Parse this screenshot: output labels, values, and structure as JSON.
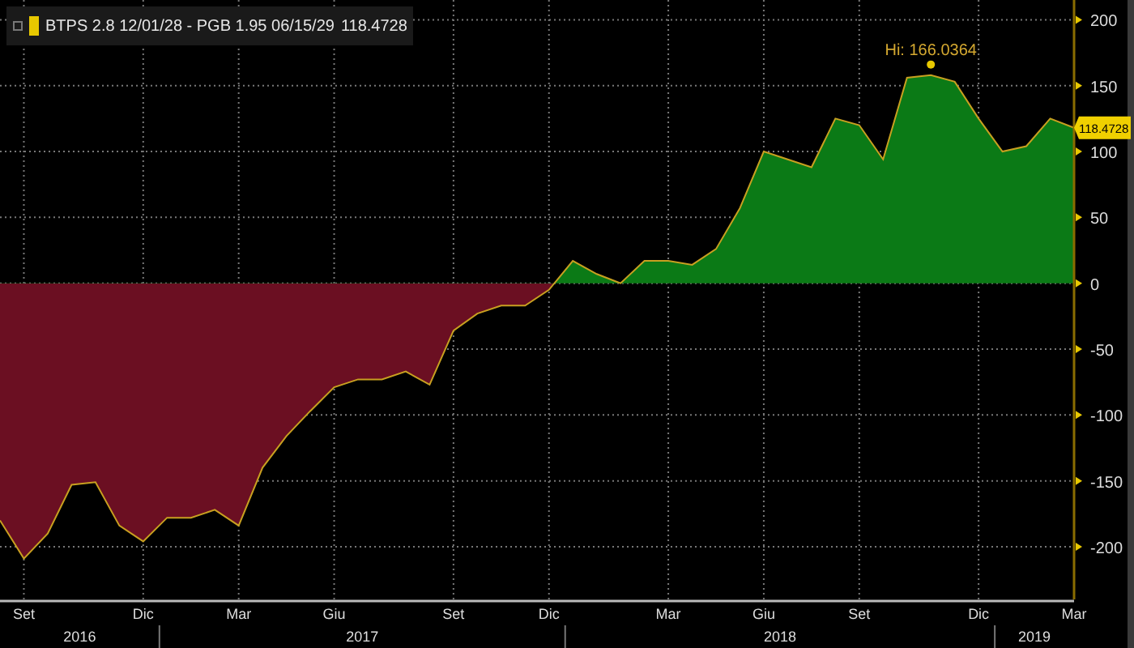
{
  "legend": {
    "value": "118.4728",
    "color": "#e8c800"
  },
  "chart_data": {
    "type": "area",
    "categories": [
      null,
      "Set",
      null,
      null,
      null,
      null,
      "Dic",
      null,
      null,
      null,
      "Mar",
      null,
      null,
      null,
      "Giu",
      null,
      null,
      null,
      null,
      "Set",
      null,
      null,
      null,
      "Dic",
      null,
      null,
      null,
      null,
      "Mar",
      null,
      null,
      null,
      "Giu",
      null,
      null,
      null,
      "Set",
      null,
      null,
      null,
      null,
      "Dic",
      null,
      null,
      null,
      "Mar"
    ],
    "series": [
      {
        "name": "BTPS 2.8 12/01/28 - PGB 1.95 06/15/29",
        "color": "#c8a020",
        "values": [
          -180,
          -209,
          -190,
          -153,
          -151,
          -184,
          -196,
          -178,
          -178,
          -172,
          -184,
          -140,
          -116,
          -97,
          -79,
          -73,
          -73,
          -67,
          -77,
          -36,
          -23,
          -17,
          -17,
          -5,
          17,
          7,
          0,
          17,
          17,
          14,
          26,
          57,
          100,
          94,
          88,
          125,
          120,
          94,
          156,
          158,
          153,
          125,
          100,
          104,
          125,
          118
        ]
      }
    ],
    "ylim": [
      -240,
      215
    ],
    "yticks": [
      200,
      150,
      100,
      50,
      0,
      -50,
      -100,
      -150,
      -200
    ],
    "grid": true,
    "annotations": [
      {
        "text": "Hi: 166.0364",
        "y": 166.0364
      }
    ]
  },
  "last_value_badge": {
    "text": "118.4728"
  },
  "year_labels": [
    "2016",
    "2017",
    "2018",
    "2019"
  ]
}
